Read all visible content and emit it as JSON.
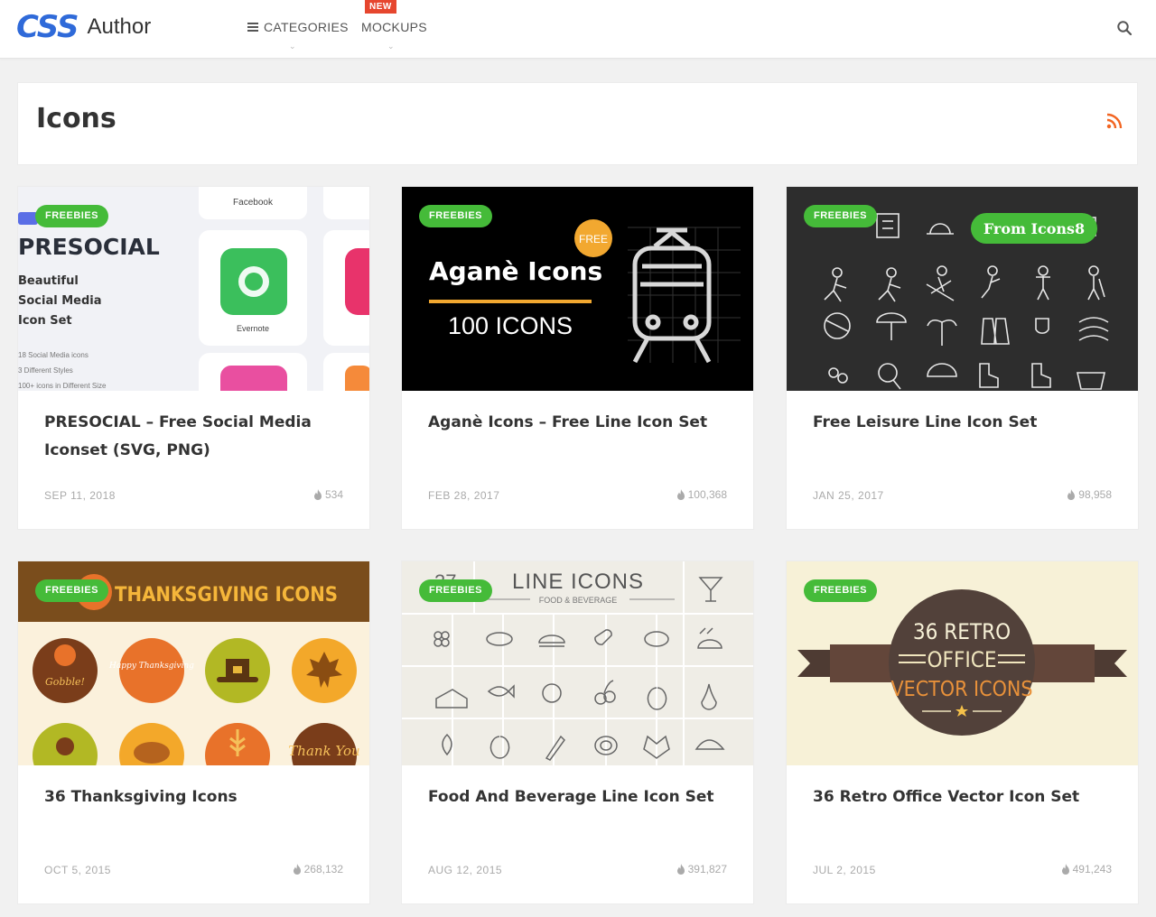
{
  "header": {
    "logo_mark": "CSS",
    "logo_text": "Author",
    "nav": [
      {
        "label": "CATEGORIES",
        "icon": "menu-icon"
      },
      {
        "label": "MOCKUPS",
        "badge": "NEW"
      }
    ],
    "search_icon": "search-icon"
  },
  "page": {
    "title": "Icons",
    "rss_icon": "rss-icon"
  },
  "cards": [
    {
      "tag": "FREEBIES",
      "title": "PRESOCIAL – Free Social Media Iconset (SVG, PNG)",
      "date": "SEP 11, 2018",
      "views": "534",
      "image": {
        "heading": "PRESOCIAL",
        "line1": "Beautiful",
        "line2": "Social Media",
        "line3": "Icon Set",
        "app1": "Facebook",
        "app2": "Evernote",
        "note1": "18 Social Media icons",
        "note2": "3 Different Styles",
        "note3": "100+ icons in Different Size"
      }
    },
    {
      "tag": "FREEBIES",
      "title": "Aganè Icons – Free Line Icon Set",
      "date": "FEB 28, 2017",
      "views": "100,368",
      "image": {
        "heading": "Aganè Icons",
        "sub": "100 ICONS",
        "badge": "FREE"
      }
    },
    {
      "tag": "FREEBIES",
      "title": "Free Leisure Line Icon Set",
      "date": "JAN 25, 2017",
      "views": "98,958",
      "image": {
        "pill": "From Icons8"
      }
    },
    {
      "tag": "FREEBIES",
      "title": "36 Thanksgiving Icons",
      "date": "OCT 5, 2015",
      "views": "268,132",
      "image": {
        "banner": "THANKSGIVING ICONS",
        "c1": "Gobble!",
        "c2": "Happy Thanksgiving",
        "c4": "Thank You"
      }
    },
    {
      "tag": "FREEBIES",
      "title": "Food And Beverage Line Icon Set",
      "date": "AUG 12, 2015",
      "views": "391,827",
      "image": {
        "heading": "LINE ICONS",
        "sub": "FOOD & BEVERAGE",
        "num": "37"
      }
    },
    {
      "tag": "FREEBIES",
      "title": "36 Retro Office Vector Icon Set",
      "date": "JUL 2, 2015",
      "views": "491,243",
      "image": {
        "line1": "36 RETRO",
        "line2": "OFFICE",
        "line3": "VECTOR ICONS"
      }
    }
  ],
  "colors": {
    "brand": "#2f6ad9",
    "tag": "#45bb39",
    "badge": "#e6462e",
    "rss": "#f26522"
  }
}
